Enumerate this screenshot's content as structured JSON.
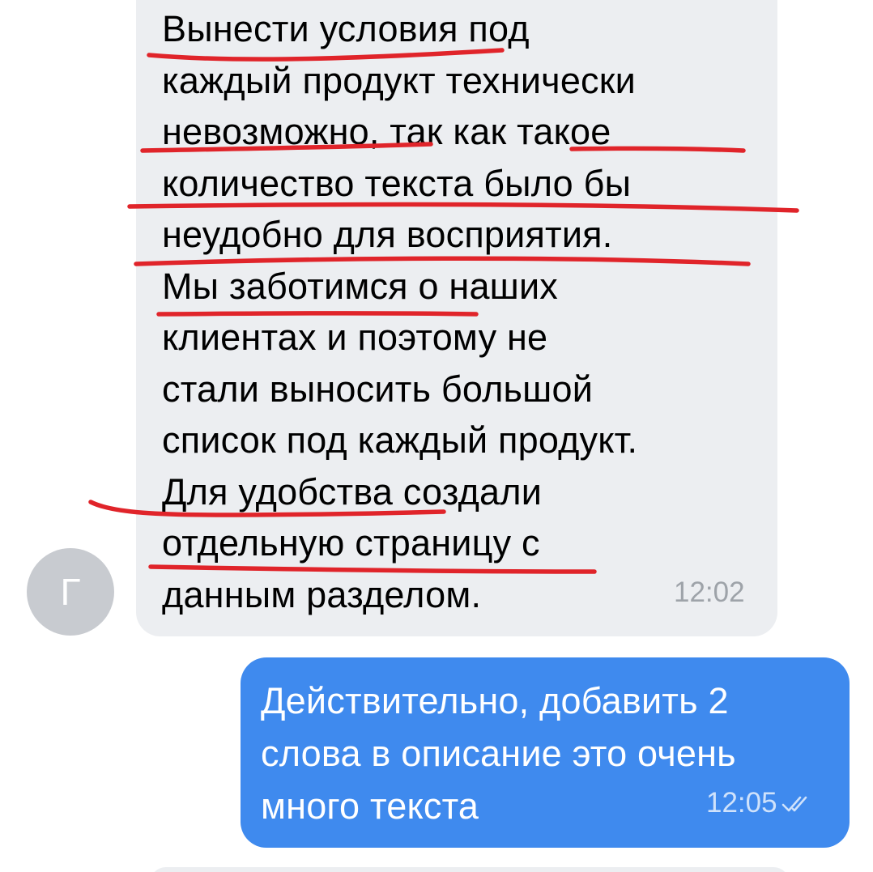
{
  "incoming": {
    "avatar_letter": "Г",
    "lines": [
      "Вынести условия под",
      "каждый продукт технически",
      "невозможно, так как такое",
      "количество текста было бы",
      "неудобно для восприятия.",
      "Мы заботимся о наших",
      "клиентах и поэтому не",
      "стали выносить большой",
      "список под каждый продукт.",
      "Для удобства создали",
      "отдельную страницу с",
      "данным разделом."
    ],
    "time": "12:02"
  },
  "outgoing": {
    "lines": [
      "Действительно, добавить 2",
      "слова в описание это очень",
      "много текста"
    ],
    "time": "12:05",
    "status_icon": "double-check-icon"
  },
  "colors": {
    "incoming_bubble": "#eceef1",
    "outgoing_bubble": "#3f8aee",
    "annotation": "#e0242a",
    "avatar": "#c8cbd0"
  }
}
